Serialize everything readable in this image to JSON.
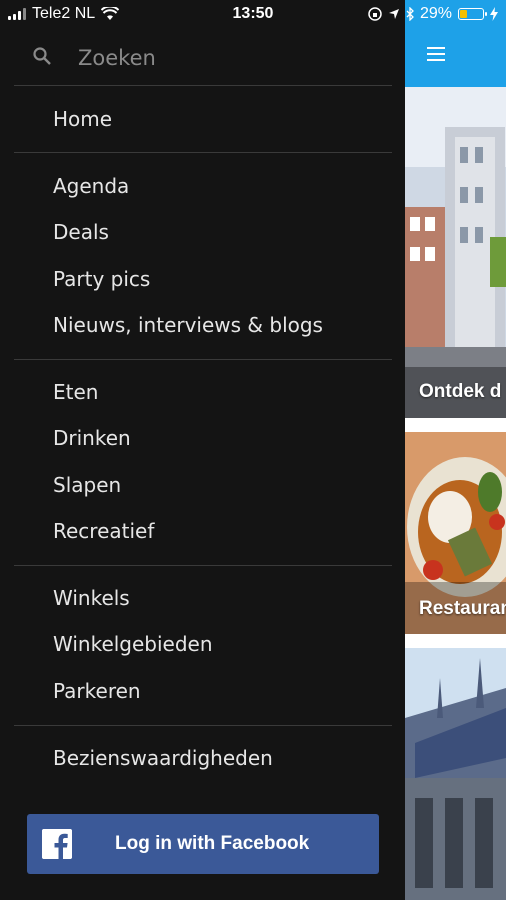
{
  "status_bar": {
    "carrier": "Tele2 NL",
    "time": "13:50",
    "battery": "29%",
    "battery_level": 0.29
  },
  "drawer": {
    "search": {
      "placeholder": "Zoeken"
    },
    "sections": [
      [
        "Home"
      ],
      [
        "Agenda",
        "Deals",
        "Party pics",
        "Nieuws, interviews & blogs"
      ],
      [
        "Eten",
        "Drinken",
        "Slapen",
        "Recreatief"
      ],
      [
        "Winkels",
        "Winkelgebieden",
        "Parkeren"
      ],
      [
        "Bezienswaardigheden"
      ]
    ],
    "facebook_label": "Log in with Facebook"
  },
  "content": {
    "cards": [
      {
        "title": "Ontdek d"
      },
      {
        "title": "Restauran"
      },
      {
        "title": ""
      }
    ]
  },
  "colors": {
    "header": "#1ea1e8",
    "drawer_bg": "#141414",
    "facebook": "#3b5998",
    "battery": "#f5c000"
  }
}
